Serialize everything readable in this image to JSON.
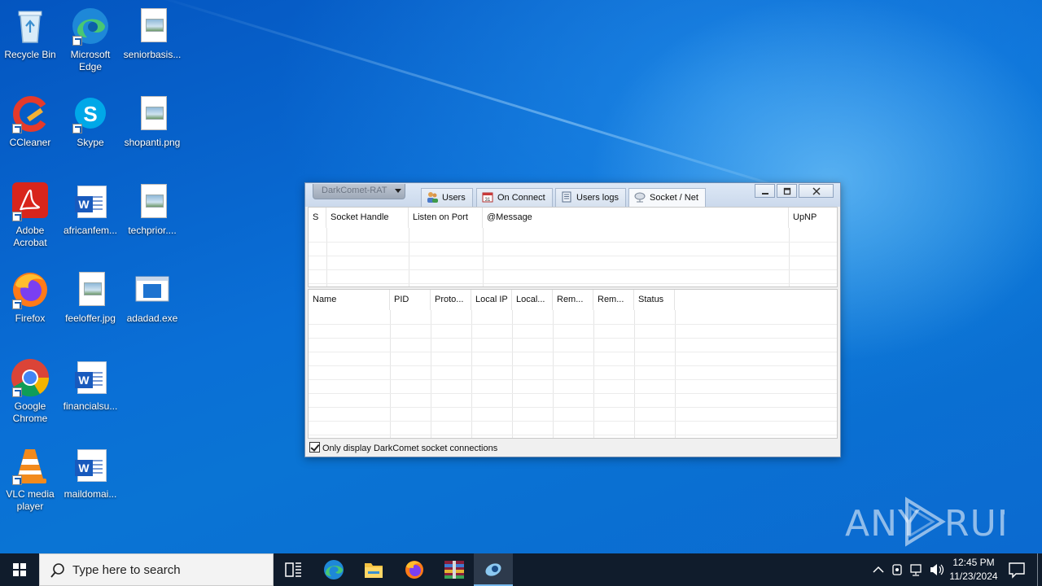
{
  "desktop": {
    "icons": [
      {
        "label": "Recycle Bin"
      },
      {
        "label": "Microsoft Edge"
      },
      {
        "label": "seniorbasis..."
      },
      {
        "label": "CCleaner"
      },
      {
        "label": "Skype"
      },
      {
        "label": "shopanti.png"
      },
      {
        "label": "Adobe Acrobat"
      },
      {
        "label": "africanfem..."
      },
      {
        "label": "techprior...."
      },
      {
        "label": "Firefox"
      },
      {
        "label": "feeloffer.jpg"
      },
      {
        "label": "adadad.exe"
      },
      {
        "label": "Google Chrome"
      },
      {
        "label": "financialsu..."
      },
      {
        "label": "VLC media player"
      },
      {
        "label": "maildomai..."
      }
    ]
  },
  "window": {
    "app_combo": "DarkComet-RAT",
    "tabs": [
      {
        "label": "Users",
        "icon": "users-icon"
      },
      {
        "label": "On Connect",
        "icon": "calendar-icon"
      },
      {
        "label": "Users logs",
        "icon": "log-icon"
      },
      {
        "label": "Socket / Net",
        "icon": "network-icon"
      }
    ],
    "active_tab": "Socket / Net",
    "socket_table": {
      "columns": [
        "S",
        "Socket Handle",
        "Listen on Port",
        "@Message",
        "UpNP"
      ],
      "rows": []
    },
    "connections_table": {
      "columns": [
        "Name",
        "PID",
        "Proto...",
        "Local IP",
        "Local...",
        "Rem...",
        "Rem...",
        "Status"
      ],
      "rows": []
    },
    "footer_checkbox": {
      "label": "Only display DarkComet socket connections",
      "checked": true
    }
  },
  "watermark": "ANY RUN",
  "taskbar": {
    "search_placeholder": "Type here to search",
    "apps": [
      "task-view",
      "microsoft-edge",
      "file-explorer",
      "firefox",
      "winrar",
      "darkcomet"
    ],
    "clock_time": "12:45 PM",
    "clock_date": "11/23/2024"
  }
}
